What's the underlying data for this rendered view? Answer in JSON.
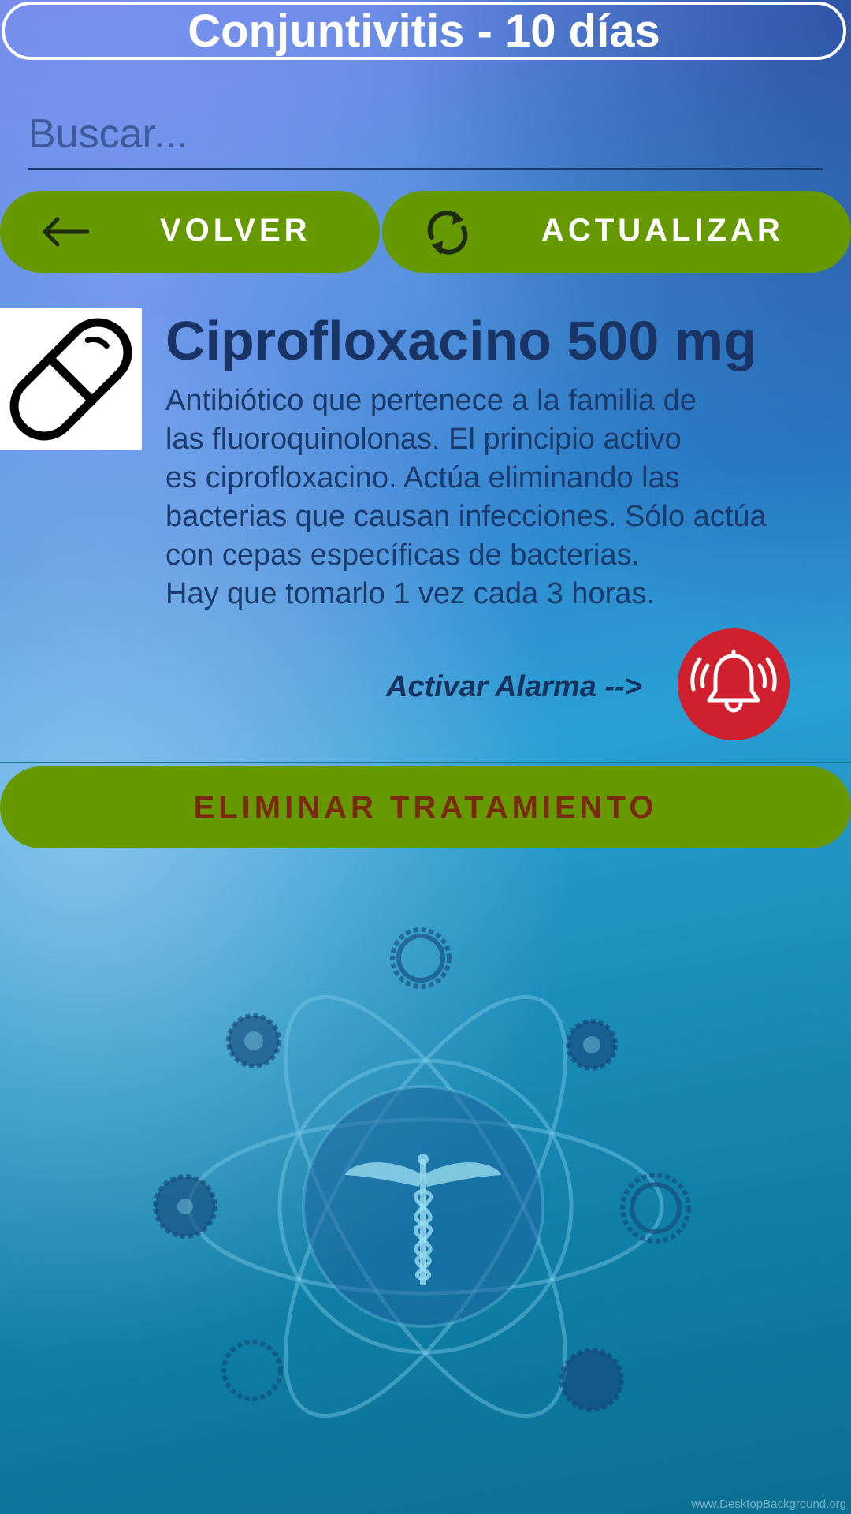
{
  "header": {
    "title": "Conjuntivitis - 10 días"
  },
  "search": {
    "placeholder": "Buscar...",
    "value": ""
  },
  "toolbar": {
    "back_label": "VOLVER",
    "back_icon": "arrow-left-icon",
    "refresh_label": "ACTUALIZAR",
    "refresh_icon": "refresh-icon"
  },
  "medicine": {
    "icon": "pill-icon",
    "name": "Ciprofloxacino 500 mg",
    "description_lines": [
      "Antibiótico que pertenece a la familia de",
      "las fluoroquinolonas. El principio activo",
      "es ciprofloxacino. Actúa eliminando las",
      "bacterias que causan infecciones. Sólo actúa",
      "con cepas específicas de bacterias.",
      "Hay que tomarlo 1 vez cada 3 horas."
    ]
  },
  "alarm": {
    "label": "Activar Alarma -->",
    "icon": "alarm-bell-icon"
  },
  "actions": {
    "delete_label": "ELIMINAR TRATAMIENTO"
  },
  "background": {
    "illustration": "caduceus-atom-gears-illustration",
    "watermark": "www.DesktopBackground.org"
  },
  "colors": {
    "button_green": "#669900",
    "alarm_red": "#d0202e",
    "delete_text": "#7a2a10",
    "title_text": "#ffffff"
  }
}
